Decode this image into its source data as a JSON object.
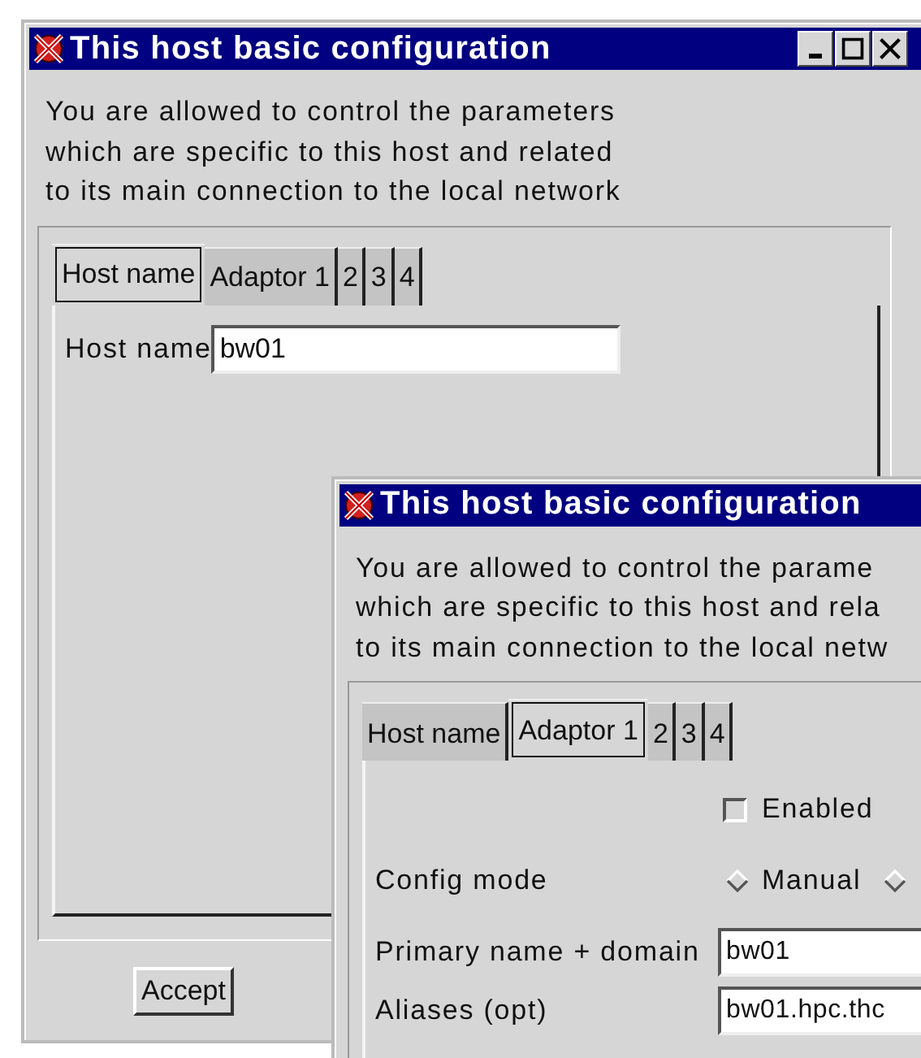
{
  "windows": [
    {
      "title": "This host basic configuration",
      "controls": [
        {
          "kind": "minimize"
        },
        {
          "kind": "maximize"
        },
        {
          "kind": "close"
        }
      ],
      "description": [
        "You are allowed to control the parameters",
        "which are specific to this host and related",
        "to its main connection to the local network"
      ],
      "tabs": [
        {
          "label": "Host name",
          "selected": true
        },
        {
          "label": "Adaptor 1",
          "selected": false
        },
        {
          "label": "2",
          "selected": false
        },
        {
          "label": "3",
          "selected": false
        },
        {
          "label": "4",
          "selected": false
        }
      ],
      "rows": [
        {
          "kind": "field",
          "label": "Host name",
          "value": "bw01"
        }
      ],
      "buttons": [
        "Accept"
      ]
    },
    {
      "title": "This host basic configuration",
      "description": [
        "You are allowed to control the parame",
        "which are specific to this host and rela",
        "to its main connection to the local netw"
      ],
      "tabs": [
        {
          "label": "Host name",
          "selected": false
        },
        {
          "label": "Adaptor 1",
          "selected": true
        },
        {
          "label": "2",
          "selected": false
        },
        {
          "label": "3",
          "selected": false
        },
        {
          "label": "4",
          "selected": false
        }
      ],
      "rows": [
        {
          "kind": "checkbox",
          "label": "Enabled",
          "checked": false
        },
        {
          "kind": "radio",
          "label": "Config mode",
          "options": [
            {
              "label": "Manual",
              "selected": false
            },
            {
              "selected": false
            }
          ]
        },
        {
          "kind": "field",
          "label": "Primary name + domain",
          "value": "bw01"
        },
        {
          "kind": "field",
          "label": "Aliases (opt)",
          "value": "bw01.hpc.thc"
        }
      ]
    }
  ]
}
